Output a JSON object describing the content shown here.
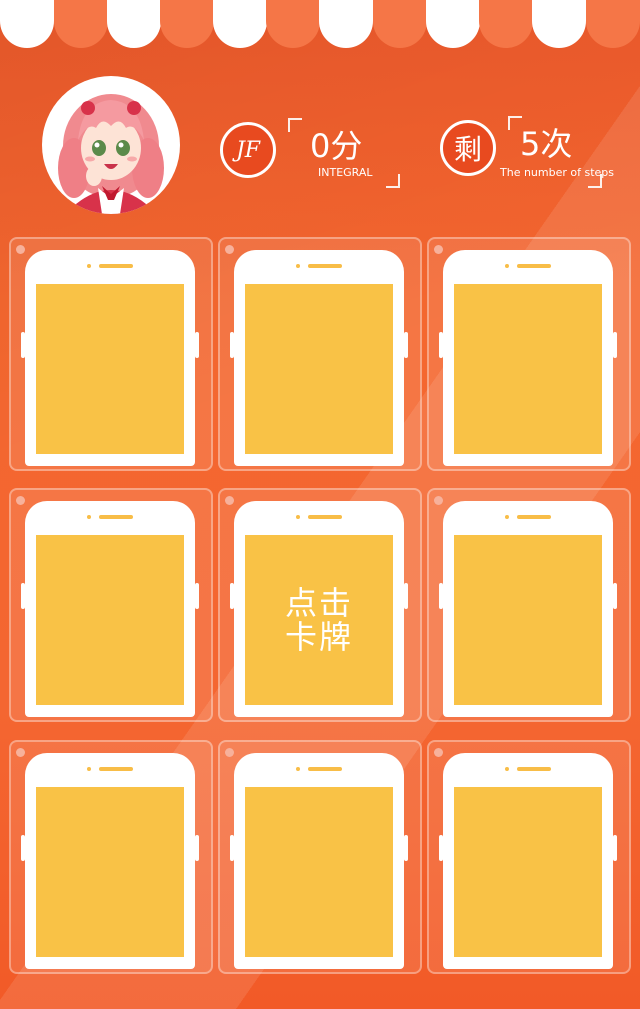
{
  "stats": {
    "score_value": "0分",
    "score_label": "INTEGRAL",
    "score_badge": "JF",
    "steps_value": "5次",
    "steps_label": "The number of steps",
    "steps_badge": "剩"
  },
  "avatar": {
    "icon": "anime-girl-avatar"
  },
  "grid": {
    "cards": [
      {
        "text": ""
      },
      {
        "text": ""
      },
      {
        "text": ""
      },
      {
        "text": ""
      },
      {
        "text": "点击卡牌"
      },
      {
        "text": ""
      },
      {
        "text": ""
      },
      {
        "text": ""
      },
      {
        "text": ""
      }
    ]
  },
  "colors": {
    "background": "#f4672f",
    "card_screen": "#f9c246",
    "badge": "#e84a1f"
  }
}
